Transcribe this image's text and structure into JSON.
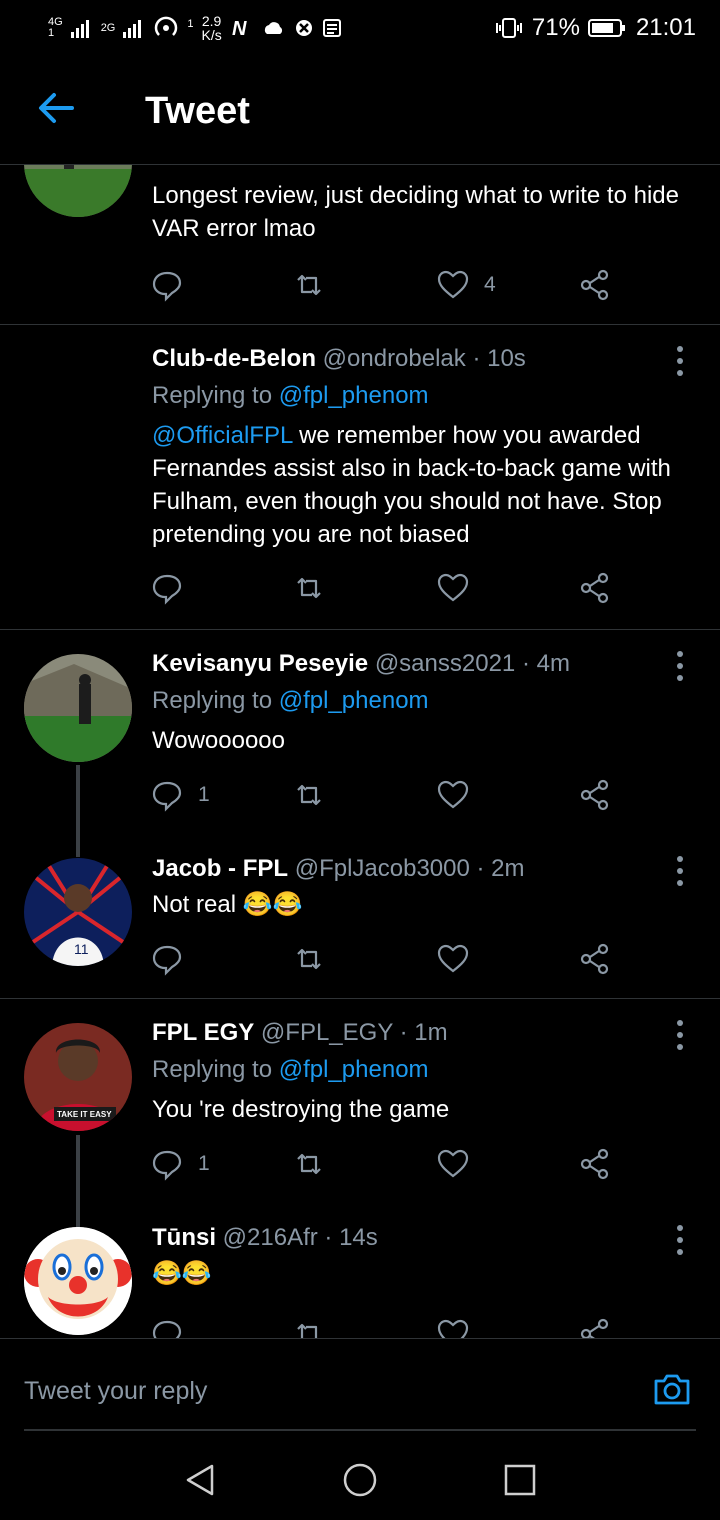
{
  "status": {
    "net1": "4G",
    "net1_sub": "1",
    "net2": "2G",
    "data_speed_value": "2.9",
    "data_speed_unit": "K/s",
    "hotspot_count": "1",
    "battery": "71%",
    "time": "21:01"
  },
  "header": {
    "title": "Tweet"
  },
  "tweets": [
    {
      "body": "Longest review, just deciding what to write to hide VAR error lmao",
      "likes": "4"
    },
    {
      "name": "Club-de-Belon",
      "handle": "@ondrobelak",
      "time": "· 10s",
      "replying_prefix": "Replying to",
      "replying_to": "@fpl_phenom",
      "body_mention": "@OfficialFPL",
      "body": "we remember how you awarded Fernandes assist also in back-to-back game with Fulham, even though you should not have. Stop pretending you are not biased"
    },
    {
      "name": "Kevisanyu Peseyie",
      "handle": "@sanss2021",
      "time": "· 4m",
      "replying_prefix": "Replying to",
      "replying_to": "@fpl_phenom",
      "body": "Wowoooooo",
      "replies": "1"
    },
    {
      "name": "Jacob - FPL",
      "handle": "@FplJacob3000",
      "time": "· 2m",
      "body": "Not real 😂😂"
    },
    {
      "name": "FPL EGY",
      "handle": "@FPL_EGY",
      "time": "· 1m",
      "replying_prefix": "Replying to",
      "replying_to": "@fpl_phenom",
      "body": "You 're destroying the game",
      "replies": "1",
      "avatar_text": "TAKE IT EASY"
    },
    {
      "name": "Tūnsi",
      "handle": "@216Afr",
      "time": "· 14s",
      "body": "😂😂"
    }
  ],
  "reply_bar": {
    "placeholder": "Tweet your reply"
  },
  "colors": {
    "accent": "#1d9bf0",
    "muted": "#8b98a5",
    "divider": "#2f3336"
  }
}
